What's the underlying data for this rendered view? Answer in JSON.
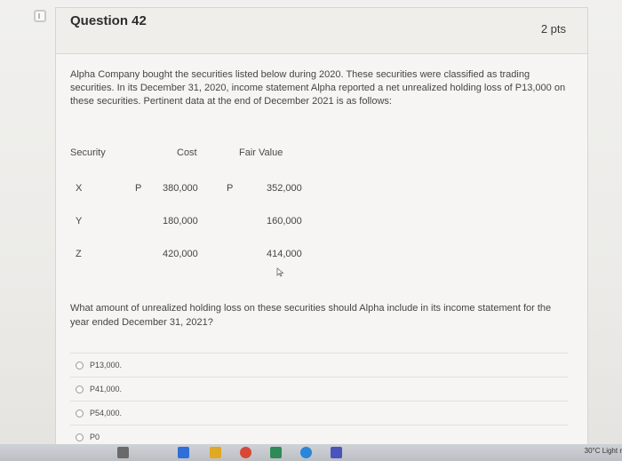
{
  "question": {
    "title": "Question 42",
    "points": "2 pts",
    "prompt": "Alpha Company bought the securities listed below during 2020. These securities were classified as trading securities. In its December 31, 2020, income statement Alpha reported a net unrealized holding loss of P13,000 on these securities. Pertinent data at the end of December 2021 is as follows:",
    "followup": "What amount of unrealized holding loss on these securities should Alpha include in its income statement for the year ended December 31, 2021?"
  },
  "table": {
    "headers": [
      "Security",
      "Cost",
      "Fair Value"
    ],
    "currency_symbol": "P",
    "rows": [
      {
        "security": "X",
        "cost": "380,000",
        "fair_value": "352,000"
      },
      {
        "security": "Y",
        "cost": "180,000",
        "fair_value": "160,000"
      },
      {
        "security": "Z",
        "cost": "420,000",
        "fair_value": "414,000"
      }
    ]
  },
  "answers": [
    {
      "label": "P13,000."
    },
    {
      "label": "P41,000."
    },
    {
      "label": "P54,000."
    },
    {
      "label": "P0"
    }
  ],
  "taskbar": {
    "weather": "30°C Light r",
    "icons": [
      {
        "name": "task-view-icon",
        "color": "#6a6a6a"
      },
      {
        "name": "calculator-icon",
        "color": "#2f6fd6"
      },
      {
        "name": "file-explorer-icon",
        "color": "#e0a823"
      },
      {
        "name": "chrome-icon",
        "color": "#d64937"
      },
      {
        "name": "messenger-icon",
        "color": "#2e8b57"
      },
      {
        "name": "edge-icon",
        "color": "#2a86d8"
      },
      {
        "name": "teams-icon",
        "color": "#4b53bc"
      }
    ]
  }
}
